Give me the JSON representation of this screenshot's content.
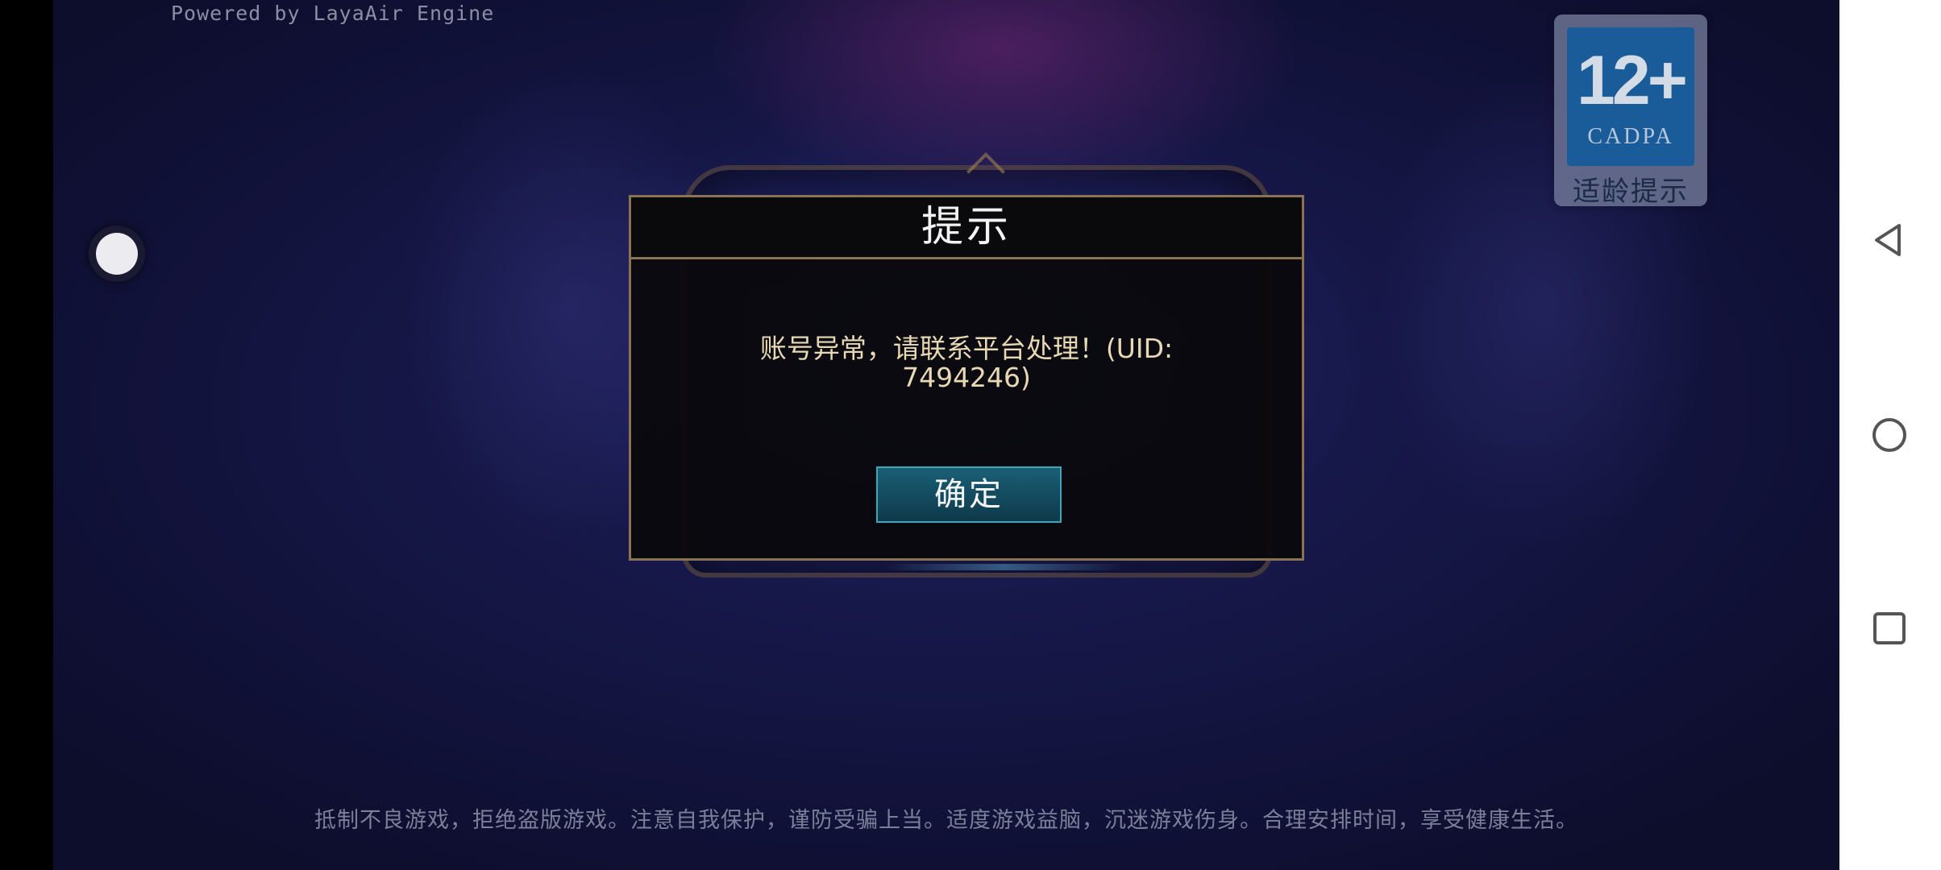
{
  "game": {
    "engine_credit": "Powered by LayaAir Engine",
    "age_rating": {
      "number": "12+",
      "organization": "CADPA",
      "caption": "适龄提示"
    },
    "dialog": {
      "title": "提示",
      "message_line1": "账号异常，请联系平台处理！(UID:",
      "message_line2": "7494246)",
      "confirm_label": "确定"
    },
    "health_notice": "抵制不良游戏，拒绝盗版游戏。注意自我保护，谨防受骗上当。适度游戏益脑，沉迷游戏伤身。合理安排时间，享受健康生活。"
  },
  "navigation": {
    "back_icon": "triangle-back-icon",
    "home_icon": "circle-home-icon",
    "recents_icon": "square-recents-icon"
  },
  "colors": {
    "dialog_border": "#8a7352",
    "button_fill": "#134a5e",
    "button_border": "#3fa5b8",
    "message_text": "#e8d9b4",
    "badge_blue": "#1a5b99"
  }
}
